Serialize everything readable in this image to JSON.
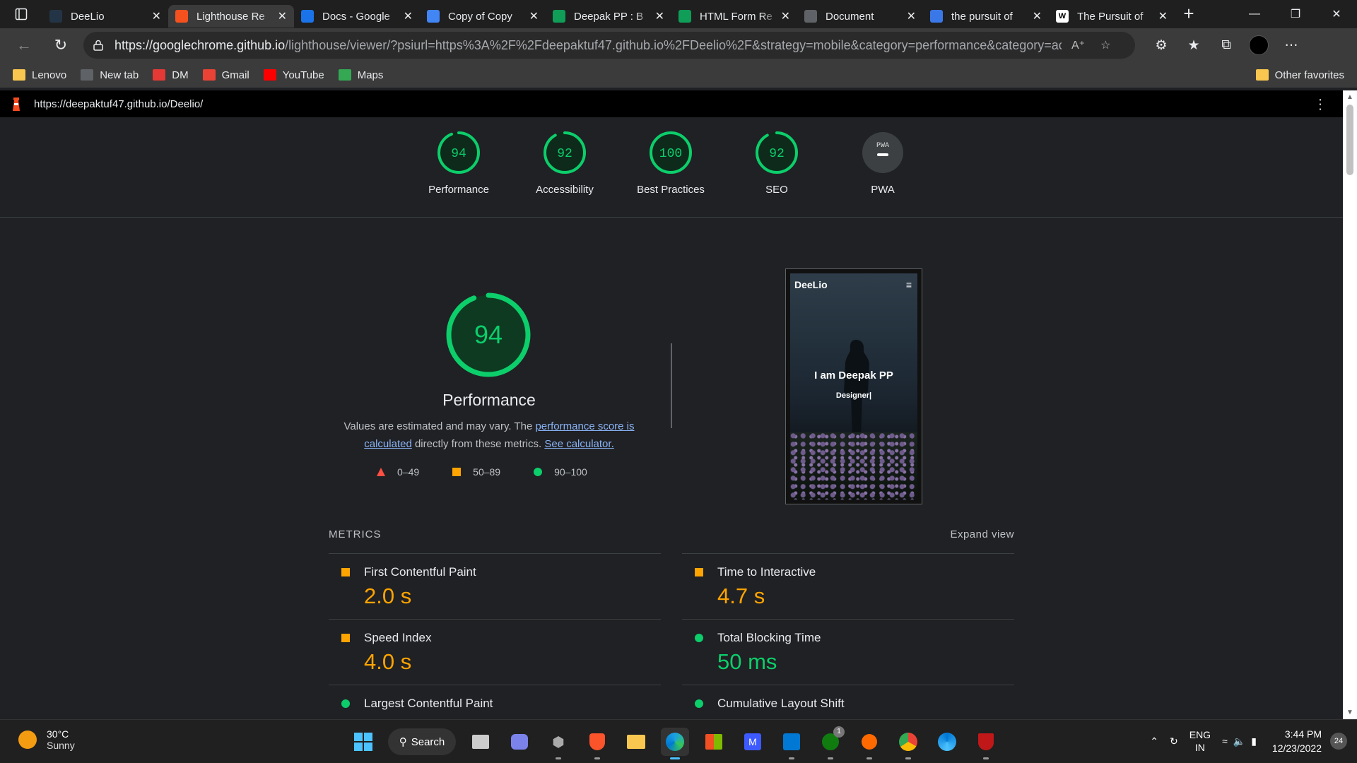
{
  "browser": {
    "tabs": [
      {
        "title": "DeeLio",
        "favicon": "deelio-favicon",
        "color": "#243447",
        "active": false
      },
      {
        "title": "Lighthouse Re",
        "favicon": "lighthouse-icon",
        "color": "#f4511e",
        "active": true
      },
      {
        "title": "Docs - Google",
        "favicon": "google-drive-icon",
        "color": "#1a73e8",
        "active": false
      },
      {
        "title": "Copy of Copy",
        "favicon": "google-docs-icon",
        "color": "#4285f4",
        "active": false
      },
      {
        "title": "Deepak PP : B",
        "favicon": "google-sheets-icon",
        "color": "#0f9d58",
        "active": false
      },
      {
        "title": "HTML Form Re",
        "favicon": "google-sheets-icon",
        "color": "#0f9d58",
        "active": false
      },
      {
        "title": "Document",
        "favicon": "document-icon",
        "color": "#5f6368",
        "active": false
      },
      {
        "title": "the pursuit of",
        "favicon": "search-icon",
        "color": "#3b78e7",
        "active": false
      },
      {
        "title": "The Pursuit of",
        "favicon": "wikipedia-icon",
        "color": "#ffffff",
        "active": false
      }
    ],
    "url_host": "https://googlechrome.github.io",
    "url_rest": "/lighthouse/viewer/?psiurl=https%3A%2F%2Fdeepaktuf47.github.io%2FDeelio%2F&strategy=mobile&category=performance&category=ac...",
    "favorites": [
      {
        "label": "Lenovo",
        "icon": "folder-icon",
        "color": "#f9c74f"
      },
      {
        "label": "New tab",
        "icon": "new-tab-icon",
        "color": "#5f6368"
      },
      {
        "label": "DM",
        "icon": "pdf-icon",
        "color": "#e53935"
      },
      {
        "label": "Gmail",
        "icon": "gmail-icon",
        "color": "#ea4335"
      },
      {
        "label": "YouTube",
        "icon": "youtube-icon",
        "color": "#ff0000"
      },
      {
        "label": "Maps",
        "icon": "maps-icon",
        "color": "#34a853"
      }
    ],
    "other_favorites": "Other favorites"
  },
  "report": {
    "page_url": "https://deepaktuf47.github.io/Deelio/",
    "gauges": [
      {
        "label": "Performance",
        "score": 94,
        "score_text": "94"
      },
      {
        "label": "Accessibility",
        "score": 92,
        "score_text": "92"
      },
      {
        "label": "Best Practices",
        "score": 100,
        "score_text": "100"
      },
      {
        "label": "SEO",
        "score": 92,
        "score_text": "92"
      },
      {
        "label": "PWA",
        "score": null,
        "score_text": "PWA"
      }
    ],
    "performance": {
      "score": 94,
      "score_text": "94",
      "title": "Performance",
      "desc_1": "Values are estimated and may vary. The ",
      "link_1": "performance score is calculated",
      "desc_2": " directly from these metrics. ",
      "link_2": "See calculator."
    },
    "legend": [
      {
        "range": "0–49",
        "shape": "triangle",
        "color": "#ff4e42"
      },
      {
        "range": "50–89",
        "shape": "square",
        "color": "#ffa400"
      },
      {
        "range": "90–100",
        "shape": "circle",
        "color": "#0cce6b"
      }
    ],
    "screenshot": {
      "site_name": "DeeLio",
      "headline": "I am Deepak PP",
      "subline": "Designer|"
    },
    "metrics_title": "METRICS",
    "expand_view": "Expand view",
    "metrics": [
      {
        "name": "First Contentful Paint",
        "value": "2.0 s",
        "rating": "average"
      },
      {
        "name": "Time to Interactive",
        "value": "4.7 s",
        "rating": "average"
      },
      {
        "name": "Speed Index",
        "value": "4.0 s",
        "rating": "average"
      },
      {
        "name": "Total Blocking Time",
        "value": "50 ms",
        "rating": "pass"
      },
      {
        "name": "Largest Contentful Paint",
        "value": "",
        "rating": "pass"
      },
      {
        "name": "Cumulative Layout Shift",
        "value": "",
        "rating": "pass"
      }
    ]
  },
  "taskbar": {
    "temperature": "30°C",
    "condition": "Sunny",
    "search_label": "Search",
    "xbox_badge": "1",
    "lang_1": "ENG",
    "lang_2": "IN",
    "time": "3:44 PM",
    "date": "12/23/2022",
    "notifications": "24"
  }
}
